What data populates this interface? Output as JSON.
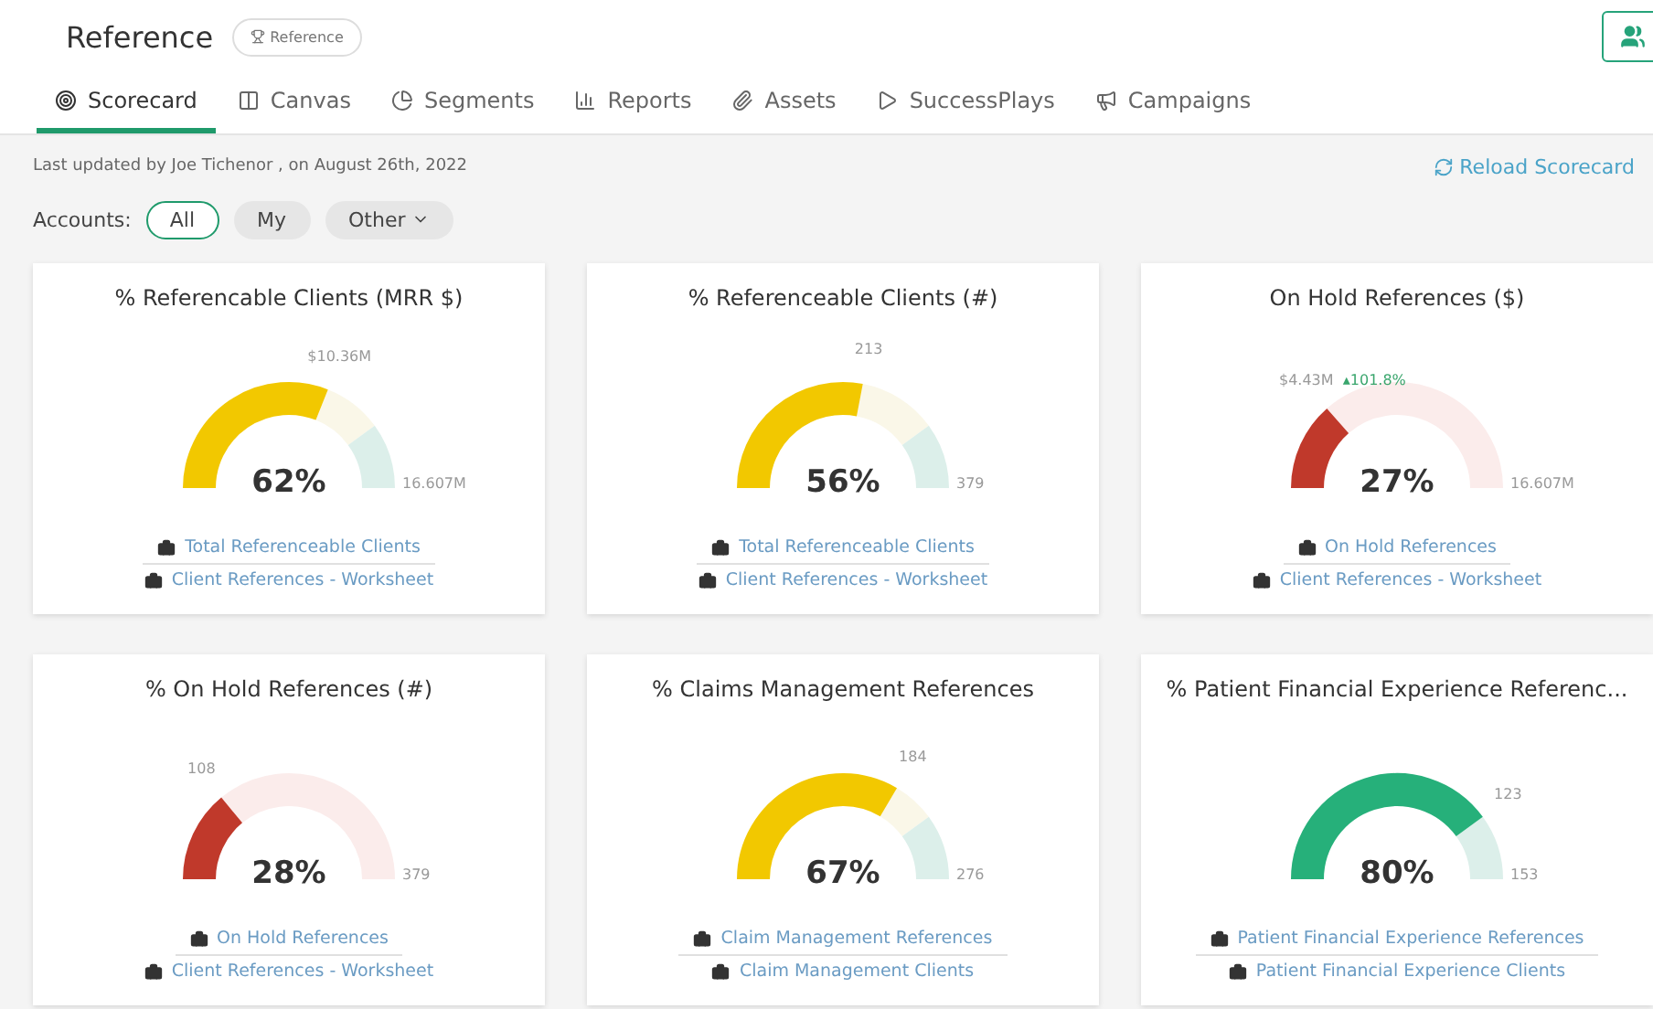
{
  "header": {
    "title": "Reference",
    "badge": "Reference"
  },
  "tabs": [
    {
      "label": "Scorecard",
      "selected": true
    },
    {
      "label": "Canvas",
      "selected": false
    },
    {
      "label": "Segments",
      "selected": false
    },
    {
      "label": "Reports",
      "selected": false
    },
    {
      "label": "Assets",
      "selected": false
    },
    {
      "label": "SuccessPlays",
      "selected": false
    },
    {
      "label": "Campaigns",
      "selected": false
    }
  ],
  "updated": "Last updated by Joe Tichenor , on August 26th, 2022",
  "reload": "Reload Scorecard",
  "filter": {
    "label": "Accounts:",
    "options": [
      {
        "label": "All",
        "selected": true
      },
      {
        "label": "My",
        "selected": false
      },
      {
        "label": "Other",
        "selected": false
      }
    ]
  },
  "cards": [
    {
      "title": "% Referencable Clients (MRR $)",
      "gauge": {
        "kind": "goal",
        "color": "#f2c800",
        "value": "62%",
        "top_label": "$10.36M",
        "end_label": "16.607M"
      },
      "links": [
        "Total Referenceable Clients",
        "Client References - Worksheet"
      ]
    },
    {
      "title": "% Referenceable Clients (#)",
      "gauge": {
        "kind": "goal",
        "color": "#f2c800",
        "value": "56%",
        "top_label": "213",
        "end_label": "379"
      },
      "links": [
        "Total Referenceable Clients",
        "Client References - Worksheet"
      ]
    },
    {
      "title": "On Hold References ($)",
      "gauge": {
        "kind": "hold",
        "color": "#c0392b",
        "value": "27%",
        "top_label": "$4.43M",
        "delta": "▴101.8%",
        "end_label": "16.607M"
      },
      "links": [
        "On Hold References",
        "Client References - Worksheet"
      ]
    },
    {
      "title": "% On Hold References (#)",
      "gauge": {
        "kind": "hold",
        "color": "#c0392b",
        "value": "28%",
        "top_label": "108",
        "end_label": "379"
      },
      "links": [
        "On Hold References",
        "Client References - Worksheet"
      ]
    },
    {
      "title": "% Claims Management References",
      "gauge": {
        "kind": "goal",
        "color": "#f2c800",
        "value": "67%",
        "top_label": "184",
        "end_label": "276"
      },
      "links": [
        "Claim Management References",
        "Claim Management Clients"
      ]
    },
    {
      "title": "% Patient Financial Experience Referenc...",
      "gauge": {
        "kind": "goal",
        "color": "#26b07a",
        "value": "80%",
        "top_label": "123",
        "end_label": "153"
      },
      "links": [
        "Patient Financial Experience References",
        "Patient Financial Experience Clients"
      ]
    }
  ]
}
